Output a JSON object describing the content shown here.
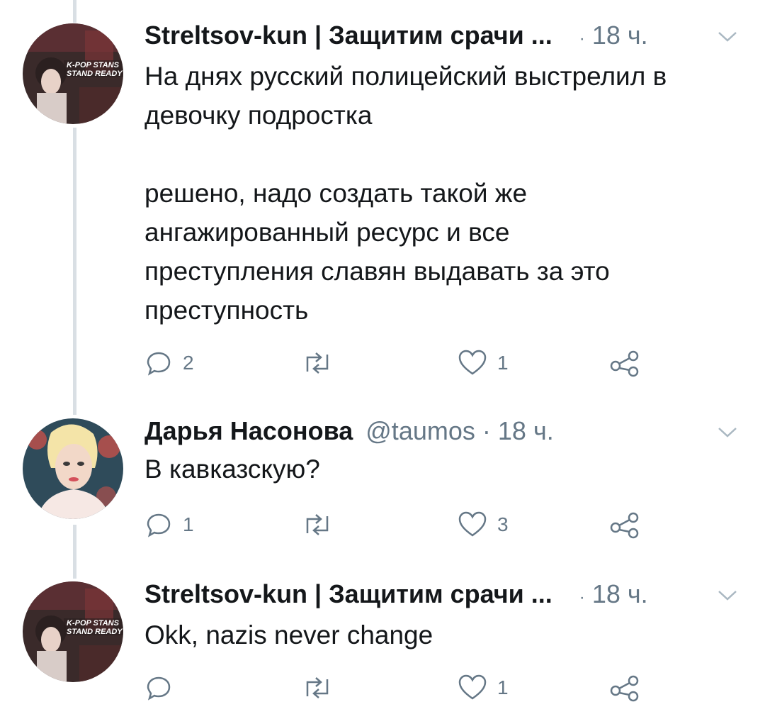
{
  "tweets": [
    {
      "author": "Streltsov-kun | Защитим срачи ...",
      "handle": "",
      "separator": "·",
      "time": "18 ч.",
      "avatar": {
        "badge_line1": "K-POP  STANS",
        "badge_line2": "STAND READY"
      },
      "paragraphs": [
        "На днях русский полицейский выстрелил в девочку подростка",
        "решено, надо создать такой же ангажированный ресурс и все преступления славян выдавать за это преступность"
      ],
      "replies": "2",
      "retweets": "",
      "likes": "1"
    },
    {
      "author": "Дарья Насонова",
      "handle": "@taumos",
      "separator": "·",
      "time": "18 ч.",
      "paragraphs": [
        "В кавказскую?"
      ],
      "replies": "1",
      "retweets": "",
      "likes": "3"
    },
    {
      "author": "Streltsov-kun | Защитим срачи ...",
      "handle": "",
      "separator": "·",
      "time": "18 ч.",
      "avatar": {
        "badge_line1": "K-POP  STANS",
        "badge_line2": "STAND READY"
      },
      "paragraphs": [
        "Okk, nazis never change"
      ],
      "replies": "",
      "retweets": "",
      "likes": "1"
    }
  ],
  "icons": {
    "reply": "reply-icon",
    "retweet": "retweet-icon",
    "like": "heart-icon",
    "share": "share-icon",
    "menu": "chevron-down-icon"
  },
  "colors": {
    "text": "#14171a",
    "muted": "#657786",
    "thread_line": "#d9dfe4"
  }
}
